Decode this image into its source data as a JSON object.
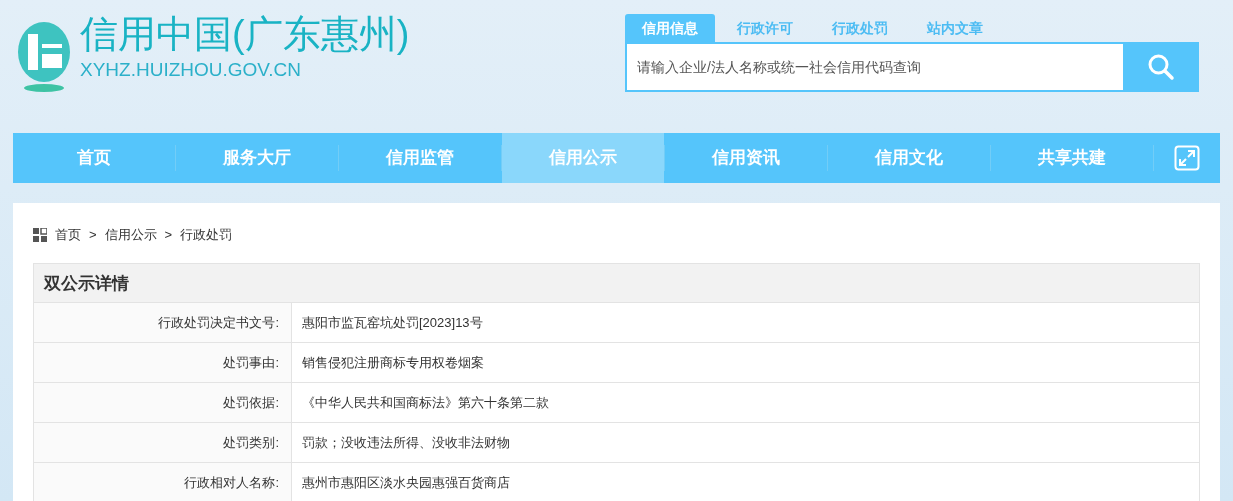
{
  "site": {
    "title": "信用中国(广东惠州)",
    "url": "XYHZ.HUIZHOU.GOV.CN"
  },
  "search": {
    "tabs": [
      {
        "label": "信用信息",
        "selected": true
      },
      {
        "label": "行政许可",
        "selected": false
      },
      {
        "label": "行政处罚",
        "selected": false
      },
      {
        "label": "站内文章",
        "selected": false
      }
    ],
    "placeholder": "请输入企业/法人名称或统一社会信用代码查询"
  },
  "nav": [
    {
      "label": "首页",
      "selected": false
    },
    {
      "label": "服务大厅",
      "selected": false
    },
    {
      "label": "信用监管",
      "selected": false
    },
    {
      "label": "信用公示",
      "selected": true
    },
    {
      "label": "信用资讯",
      "selected": false
    },
    {
      "label": "信用文化",
      "selected": false
    },
    {
      "label": "共享共建",
      "selected": false
    }
  ],
  "breadcrumb": [
    "首页",
    "信用公示",
    "行政处罚"
  ],
  "breadcrumb_separator": ">",
  "detail": {
    "title": "双公示详情",
    "rows": [
      {
        "label": "行政处罚决定书文号:",
        "value": "惠阳市监瓦窑坑处罚[2023]13号"
      },
      {
        "label": "处罚事由:",
        "value": "销售侵犯注册商标专用权卷烟案"
      },
      {
        "label": "处罚依据:",
        "value": "《中华人民共和国商标法》第六十条第二款"
      },
      {
        "label": "处罚类别:",
        "value": "罚款；没收违法所得、没收非法财物"
      },
      {
        "label": "行政相对人名称:",
        "value": "惠州市惠阳区淡水央园惠强百货商店"
      }
    ]
  }
}
